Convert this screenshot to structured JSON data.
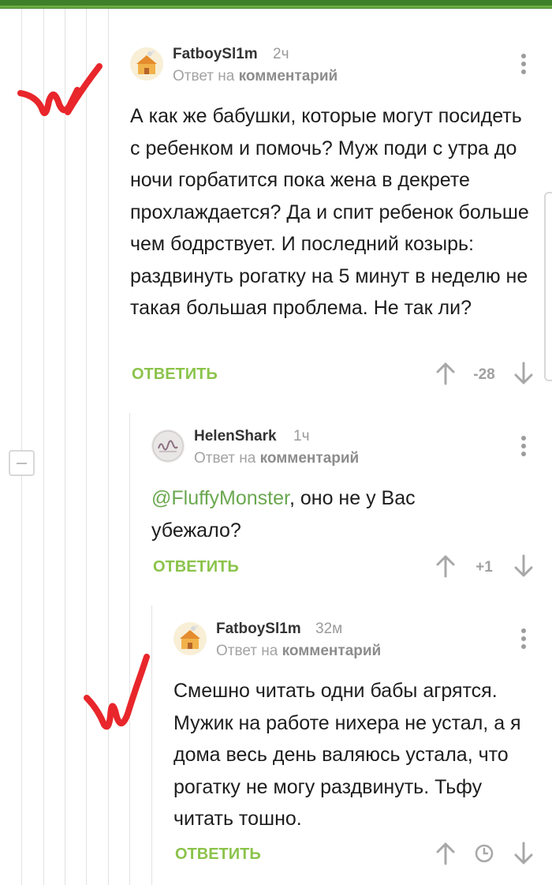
{
  "comments": [
    {
      "author": "FatboySl1m",
      "time": "2ч",
      "reply_prefix": "Ответ на ",
      "reply_target": "комментарий",
      "mention": "",
      "text": "А как же бабушки, которые могут посидеть с ребенком и помочь? Муж поди с утра до ночи горбатится пока жена в декрете прохлаждается? Да и спит ребенок больше чем бодрствует. И последний козырь: раздвинуть рогатку на 5 минут в неделю не такая большая проблема. Не так ли?",
      "reply_label": "ОТВЕТИТЬ",
      "score": "-28"
    },
    {
      "author": "HelenShark",
      "time": "1ч",
      "reply_prefix": "Ответ на ",
      "reply_target": "комментарий",
      "mention": "@FluffyMonster",
      "text": ", оно не у Вас убежало?",
      "reply_label": "ОТВЕТИТЬ",
      "score": "+1"
    },
    {
      "author": "FatboySl1m",
      "time": "32м",
      "reply_prefix": "Ответ на ",
      "reply_target": "комментарий",
      "mention": "",
      "text": "Смешно читать одни бабы агрятся. Мужик на работе нихера не устал, а я дома весь день валяюсь устала, что рогатку не могу раздвинуть. Тьфу читать тошно.",
      "reply_label": "ОТВЕТИТЬ",
      "score": ""
    }
  ],
  "icons": {
    "upvote": "arrow-up-icon",
    "downvote": "arrow-down-icon",
    "menu": "more-vertical-icon",
    "clock": "clock-icon",
    "collapse": "minus-square-icon"
  },
  "colors": {
    "accent_green": "#8bc34a",
    "mention_green": "#6aa84f",
    "header_green": "#3f7f2a",
    "annotation_red": "#e8262b"
  }
}
